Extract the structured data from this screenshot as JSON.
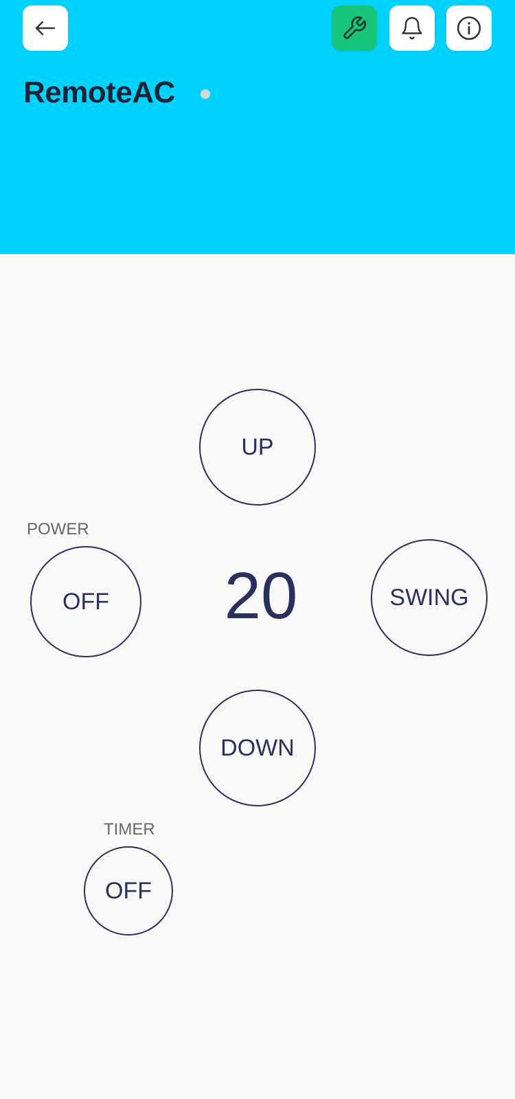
{
  "header": {
    "title": "RemoteAC",
    "background": "#00d2ff",
    "buttons": [
      {
        "name": "back",
        "icon": "arrow-left-icon"
      },
      {
        "name": "settings",
        "icon": "wrench-icon",
        "color": "#16c47a"
      },
      {
        "name": "notifications",
        "icon": "bell-icon"
      },
      {
        "name": "info",
        "icon": "info-icon"
      }
    ]
  },
  "controls": {
    "temperature": "20",
    "up_label": "UP",
    "down_label": "DOWN",
    "swing_label": "SWING",
    "power": {
      "label": "POWER",
      "value": "OFF"
    },
    "timer": {
      "label": "TIMER",
      "value": "OFF"
    },
    "accent": "#2b2f5c"
  }
}
